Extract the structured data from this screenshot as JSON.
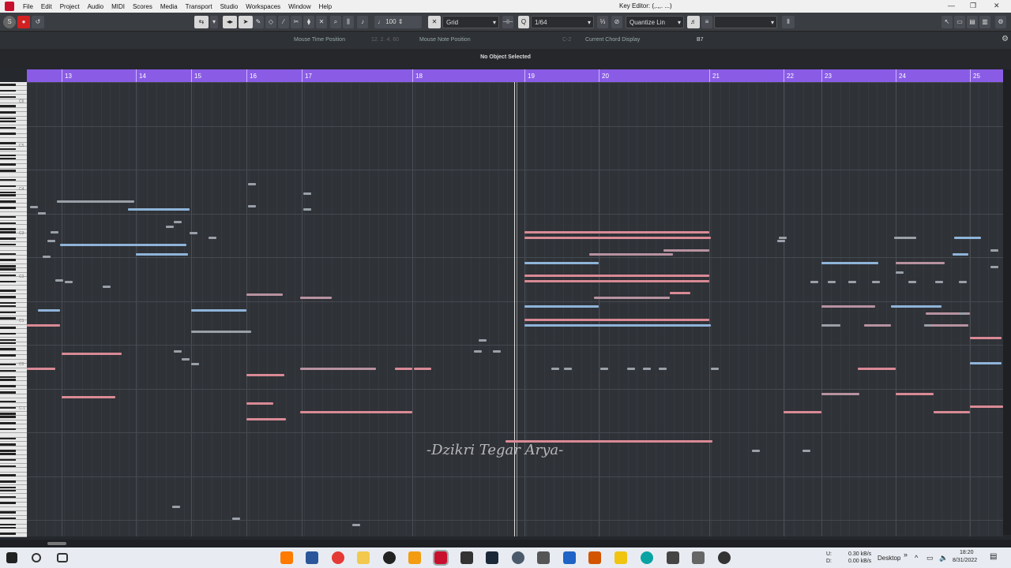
{
  "menubar": {
    "items": [
      "File",
      "Edit",
      "Project",
      "Audio",
      "MIDI",
      "Scores",
      "Media",
      "Transport",
      "Studio",
      "Workspaces",
      "Window",
      "Help"
    ],
    "window_title": "Key Editor: (,.,,. ...)",
    "controls": [
      "—",
      "❐",
      "✕"
    ]
  },
  "toolbar": {
    "velocity_value": "100",
    "grid_type": "Grid",
    "grid_value": "1/64",
    "quantize_label": "Quantize Lin"
  },
  "info": {
    "mouse_time_label": "Mouse Time Position",
    "mouse_time_value": "12. 2. 4. 60",
    "mouse_note_label": "Mouse Note Position",
    "mouse_note_value": "C-2",
    "chord_label": "Current Chord Display",
    "chord_value": "B7"
  },
  "status": "No Object Selected",
  "ruler": {
    "bars": [
      "13",
      "14",
      "15",
      "16",
      "17",
      "18",
      "19",
      "20",
      "21",
      "22",
      "23",
      "24",
      "25"
    ]
  },
  "keyboard": {
    "octave_labels": [
      "C6",
      "C5",
      "C4",
      "C3",
      "C2",
      "C1",
      "C0",
      "C-1"
    ]
  },
  "watermark": "-Dzikri Tegar Arya-",
  "colors": {
    "ruler": "#8a5ce6",
    "note_blue": "#8fb4d9",
    "note_pink": "#d98a95",
    "note_mauve": "#b892a0",
    "note_gray": "#9aa0a8"
  },
  "taskbar": {
    "net_up": "0.30 kB/s",
    "net_down": "0.00 kB/s",
    "net_labels": [
      "U:",
      "D:"
    ],
    "desktop_label": "Desktop",
    "time": "18:20",
    "date": "8/31/2022"
  }
}
